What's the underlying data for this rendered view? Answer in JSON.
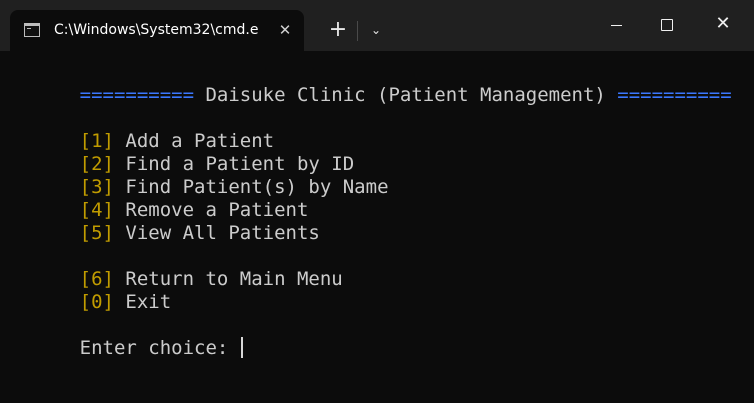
{
  "window": {
    "tab_title": "C:\\Windows\\System32\\cmd.e",
    "new_tab_symbol": "+",
    "dropdown_symbol": "⌄",
    "close_symbol": "✕"
  },
  "terminal": {
    "header_left": "==========",
    "header_title": " Daisuke Clinic (Patient Management) ",
    "header_right": "==========",
    "menu": [
      {
        "key": "[1]",
        "label": " Add a Patient"
      },
      {
        "key": "[2]",
        "label": " Find a Patient by ID"
      },
      {
        "key": "[3]",
        "label": " Find Patient(s) by Name"
      },
      {
        "key": "[4]",
        "label": " Remove a Patient"
      },
      {
        "key": "[5]",
        "label": " View All Patients"
      },
      {
        "key": "[6]",
        "label": " Return to Main Menu"
      },
      {
        "key": "[0]",
        "label": " Exit"
      }
    ],
    "prompt": "Enter choice: "
  },
  "colors": {
    "background": "#0c0c0c",
    "header_blue": "#3b78ff",
    "key_yellow": "#c19c00",
    "text": "#cccccc"
  }
}
